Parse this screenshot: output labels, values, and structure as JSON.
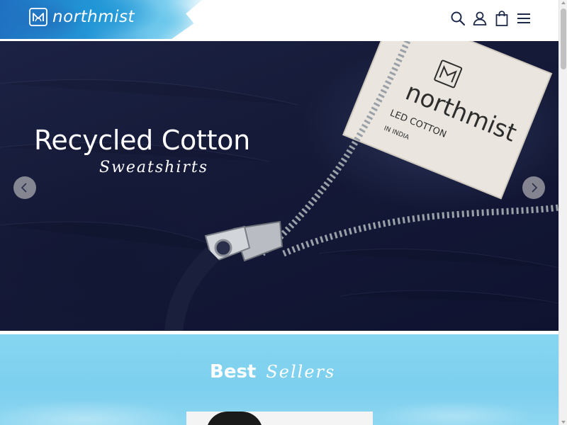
{
  "header": {
    "logo_text": "northmist",
    "icons": [
      "search-icon",
      "account-icon",
      "cart-icon",
      "menu-icon"
    ]
  },
  "hero": {
    "title": "Recycled Cotton",
    "script": "Sweatshirts",
    "label_lines": [
      "northmist",
      "LED COTTON",
      "IN INDIA"
    ]
  },
  "best_sellers": {
    "bold": "Best",
    "script": "Sellers"
  },
  "colors": {
    "hero_bg": "#151a38",
    "section_bg": "#86d6f1",
    "accent_blue": "#2495d6",
    "icon_color": "#1e2a4a"
  }
}
